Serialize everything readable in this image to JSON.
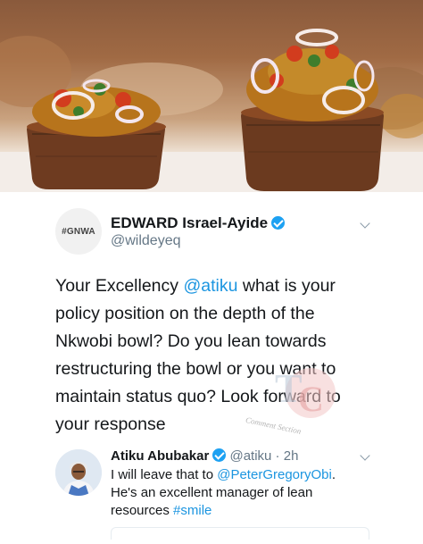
{
  "photo": {
    "alt_icon": "nkwobi-bowls-photo"
  },
  "tweet": {
    "avatar_text": "#GNWA",
    "author_name": "EDWARD Israel-Ayide",
    "author_handle": "@wildeyeq",
    "lines": [
      [
        "Your Excellency ",
        "@atiku",
        " what is your"
      ],
      [
        "policy position on the depth of the"
      ],
      [
        "Nkwobi bowl? Do you lean towards"
      ],
      [
        "restructuring the bowl or you want to"
      ],
      [
        "maintain status quo? Look forward to"
      ],
      [
        "your response"
      ]
    ]
  },
  "reply": {
    "author_name": "Atiku Abubakar",
    "author_handle": "@atiku",
    "separator": " · ",
    "time": "2h",
    "line1_prefix": "I will leave that to ",
    "line1_mention": "@PeterGregoryObi",
    "line1_suffix": ".",
    "line2": "He's an excellent manager of lean",
    "line3_prefix": "resources ",
    "line3_hashtag": "#smile"
  },
  "watermark": {
    "text": "Comment Section"
  },
  "colors": {
    "link": "#1b95e0",
    "verified": "#1da1f2",
    "muted": "#657786"
  }
}
